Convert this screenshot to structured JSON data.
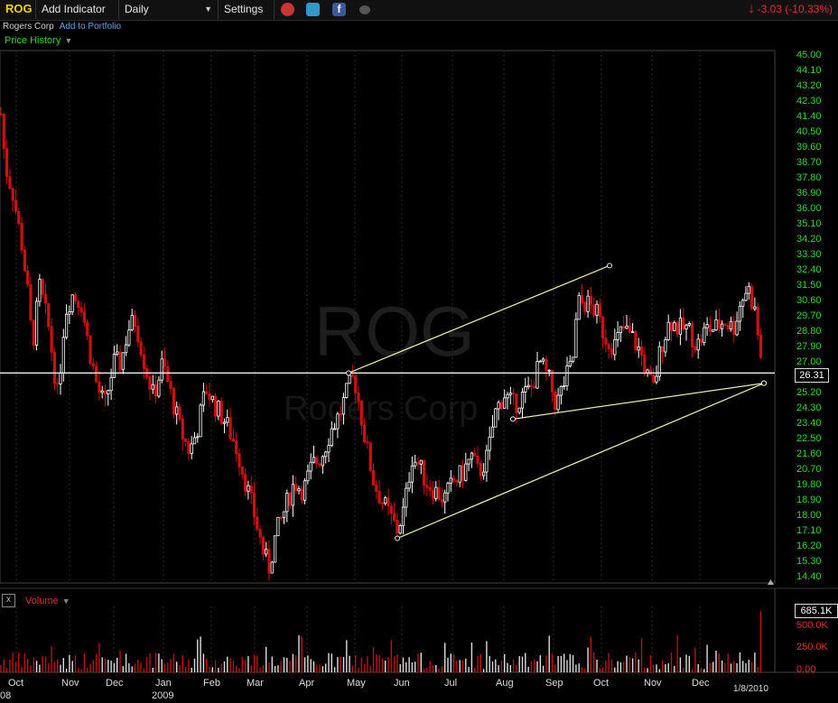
{
  "toolbar": {
    "ticker": "ROG",
    "add_indicator": "Add Indicator",
    "interval": "Daily",
    "settings": "Settings",
    "change": "-3.03 (-10.33%)"
  },
  "company": {
    "name": "Rogers Corp",
    "add_portfolio": "Add to Portfolio"
  },
  "panel": {
    "price_history": "Price History",
    "volume": "Volume",
    "close": "x"
  },
  "watermark": {
    "ticker": "ROG",
    "name": "Rogers Corp"
  },
  "last_price": "26.31",
  "last_volume": "685.1K",
  "timestamp": "1/8/2010",
  "colors": {
    "up": "#ffffff",
    "down": "#cc1111",
    "axis_price": "#2fd72f",
    "axis_volume": "#e03030",
    "trendline": "#e8e8a8"
  },
  "chart_data": {
    "type": "candlestick",
    "y_ticks": [
      "45.00",
      "44.10",
      "43.20",
      "42.30",
      "41.40",
      "40.50",
      "39.60",
      "38.70",
      "37.80",
      "36.90",
      "36.00",
      "35.10",
      "34.20",
      "33.30",
      "32.40",
      "31.50",
      "30.60",
      "29.70",
      "28.80",
      "27.90",
      "27.00",
      "26.10",
      "25.20",
      "24.30",
      "23.40",
      "22.50",
      "21.60",
      "20.70",
      "19.80",
      "18.90",
      "18.00",
      "17.10",
      "16.20",
      "15.30",
      "14.40"
    ],
    "ylim": [
      14.4,
      45.0
    ],
    "volume_ticks": [
      "500.0K",
      "250.0K",
      "0.00"
    ],
    "x_month_labels": [
      "Oct",
      "Nov",
      "Dec",
      "Jan",
      "Feb",
      "Mar",
      "Apr",
      "May",
      "Jun",
      "Jul",
      "Aug",
      "Sep",
      "Oct",
      "Nov",
      "Dec"
    ],
    "x_year_label": "2009",
    "x_edge_label": "08",
    "price_path": [
      {
        "x": 1,
        "y": 41.6
      },
      {
        "x": 6,
        "y": 38.5
      },
      {
        "x": 14,
        "y": 37.0
      },
      {
        "x": 24,
        "y": 34.0
      },
      {
        "x": 30,
        "y": 31.5
      },
      {
        "x": 36,
        "y": 28.0
      },
      {
        "x": 44,
        "y": 31.5
      },
      {
        "x": 54,
        "y": 29.0
      },
      {
        "x": 64,
        "y": 25.0
      },
      {
        "x": 72,
        "y": 30.0
      },
      {
        "x": 80,
        "y": 31.0
      },
      {
        "x": 90,
        "y": 30.5
      },
      {
        "x": 98,
        "y": 28.0
      },
      {
        "x": 108,
        "y": 25.5
      },
      {
        "x": 116,
        "y": 24.5
      },
      {
        "x": 126,
        "y": 27.0
      },
      {
        "x": 134,
        "y": 27.0
      },
      {
        "x": 142,
        "y": 29.0
      },
      {
        "x": 150,
        "y": 29.5
      },
      {
        "x": 160,
        "y": 27.0
      },
      {
        "x": 170,
        "y": 25.0
      },
      {
        "x": 180,
        "y": 27.0
      },
      {
        "x": 190,
        "y": 25.0
      },
      {
        "x": 200,
        "y": 23.0
      },
      {
        "x": 210,
        "y": 21.8
      },
      {
        "x": 218,
        "y": 23.0
      },
      {
        "x": 228,
        "y": 25.5
      },
      {
        "x": 238,
        "y": 24.5
      },
      {
        "x": 250,
        "y": 23.5
      },
      {
        "x": 262,
        "y": 22.0
      },
      {
        "x": 272,
        "y": 20.0
      },
      {
        "x": 282,
        "y": 18.0
      },
      {
        "x": 292,
        "y": 15.8
      },
      {
        "x": 298,
        "y": 15.0
      },
      {
        "x": 306,
        "y": 17.0
      },
      {
        "x": 316,
        "y": 18.5
      },
      {
        "x": 326,
        "y": 20.0
      },
      {
        "x": 336,
        "y": 19.5
      },
      {
        "x": 346,
        "y": 21.0
      },
      {
        "x": 356,
        "y": 21.5
      },
      {
        "x": 366,
        "y": 23.0
      },
      {
        "x": 376,
        "y": 24.0
      },
      {
        "x": 386,
        "y": 25.5
      },
      {
        "x": 392,
        "y": 26.2
      },
      {
        "x": 398,
        "y": 24.5
      },
      {
        "x": 406,
        "y": 22.0
      },
      {
        "x": 414,
        "y": 20.0
      },
      {
        "x": 422,
        "y": 19.0
      },
      {
        "x": 432,
        "y": 18.0
      },
      {
        "x": 440,
        "y": 17.2
      },
      {
        "x": 448,
        "y": 18.5
      },
      {
        "x": 456,
        "y": 21.5
      },
      {
        "x": 464,
        "y": 21.0
      },
      {
        "x": 472,
        "y": 20.0
      },
      {
        "x": 482,
        "y": 19.5
      },
      {
        "x": 492,
        "y": 19.0
      },
      {
        "x": 502,
        "y": 20.0
      },
      {
        "x": 512,
        "y": 20.5
      },
      {
        "x": 522,
        "y": 21.5
      },
      {
        "x": 530,
        "y": 20.5
      },
      {
        "x": 540,
        "y": 21.5
      },
      {
        "x": 548,
        "y": 24.0
      },
      {
        "x": 558,
        "y": 25.2
      },
      {
        "x": 568,
        "y": 24.5
      },
      {
        "x": 578,
        "y": 25.0
      },
      {
        "x": 588,
        "y": 25.5
      },
      {
        "x": 598,
        "y": 27.0
      },
      {
        "x": 608,
        "y": 26.0
      },
      {
        "x": 616,
        "y": 24.5
      },
      {
        "x": 626,
        "y": 26.0
      },
      {
        "x": 634,
        "y": 27.0
      },
      {
        "x": 640,
        "y": 30.5
      },
      {
        "x": 650,
        "y": 30.5
      },
      {
        "x": 660,
        "y": 30.0
      },
      {
        "x": 670,
        "y": 28.5
      },
      {
        "x": 680,
        "y": 28.0
      },
      {
        "x": 690,
        "y": 29.0
      },
      {
        "x": 700,
        "y": 28.5
      },
      {
        "x": 710,
        "y": 27.5
      },
      {
        "x": 718,
        "y": 26.0
      },
      {
        "x": 724,
        "y": 25.5
      },
      {
        "x": 732,
        "y": 28.0
      },
      {
        "x": 742,
        "y": 29.5
      },
      {
        "x": 752,
        "y": 29.0
      },
      {
        "x": 762,
        "y": 29.0
      },
      {
        "x": 772,
        "y": 28.0
      },
      {
        "x": 782,
        "y": 29.0
      },
      {
        "x": 792,
        "y": 29.0
      },
      {
        "x": 802,
        "y": 29.5
      },
      {
        "x": 812,
        "y": 29.0
      },
      {
        "x": 820,
        "y": 30.5
      },
      {
        "x": 828,
        "y": 31.5
      },
      {
        "x": 836,
        "y": 30.0
      },
      {
        "x": 842,
        "y": 27.5
      },
      {
        "x": 846,
        "y": 25.8
      }
    ],
    "horizontal_line": 26.4,
    "trendlines": [
      {
        "x1": 386,
        "y1": 26.4,
        "x2": 675,
        "y2": 32.7
      },
      {
        "x1": 440,
        "y1": 16.7,
        "x2": 846,
        "y2": 25.8
      },
      {
        "x1": 568,
        "y1": 23.7,
        "x2": 846,
        "y2": 25.8
      }
    ],
    "volume_max_k": 685.1
  }
}
